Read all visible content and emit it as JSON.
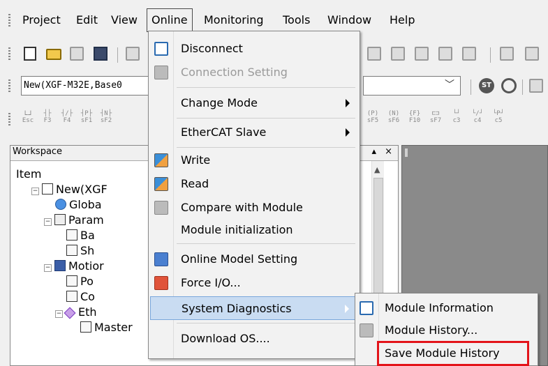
{
  "menubar": {
    "items": [
      "Project",
      "Edit",
      "View",
      "Online",
      "Monitoring",
      "Tools",
      "Window",
      "Help"
    ],
    "active": "Online"
  },
  "toolbar": {
    "model_combo_value": "New(XGF-M32E,Base0"
  },
  "ladder_toolbar": {
    "labels": [
      "Esc",
      "F3",
      "F4",
      "sF1",
      "sF2",
      "sF5",
      "sF6",
      "F10",
      "sF7",
      "c3",
      "c4",
      "c5"
    ]
  },
  "workspace": {
    "title": "Workspace",
    "header_buttons": "▴ ×",
    "tree": {
      "root_label": "Item",
      "project": "New(XGF",
      "global": "Globa",
      "param": "Param",
      "base": "Ba",
      "sh": "Sh",
      "motion": "Motior",
      "po": "Po",
      "co": "Co",
      "eth": "Eth",
      "master": "Master"
    }
  },
  "online_menu": {
    "items": [
      {
        "label": "Disconnect",
        "icon": "disconnect-icon",
        "enabled": true
      },
      {
        "label": "Connection Setting",
        "icon": "connection-setting-icon",
        "enabled": false
      },
      {
        "label": "Change Mode",
        "icon": null,
        "submenu": true
      },
      {
        "label": "EtherCAT Slave",
        "icon": null,
        "submenu": true
      },
      {
        "label": "Write",
        "icon": "write-icon"
      },
      {
        "label": "Read",
        "icon": "read-icon"
      },
      {
        "label": "Compare with Module",
        "icon": "compare-icon"
      },
      {
        "label": "Module initialization",
        "icon": null
      },
      {
        "label": "Online Model Setting",
        "icon": "model-setting-icon"
      },
      {
        "label": "Force I/O...",
        "icon": "force-io-icon"
      },
      {
        "label": "System Diagnostics",
        "icon": null,
        "submenu": true,
        "highlighted": true
      },
      {
        "label": "Download OS....",
        "icon": null
      }
    ]
  },
  "system_diagnostics_submenu": {
    "items": [
      {
        "label": "Module Information",
        "icon": "module-info-icon"
      },
      {
        "label": "Module History...",
        "icon": "module-history-icon"
      },
      {
        "label": "Save Module History",
        "icon": null,
        "emphasized": true
      }
    ]
  },
  "colors": {
    "highlight_bg": "#c9dcf2",
    "emphasis_border": "#e3141a"
  }
}
